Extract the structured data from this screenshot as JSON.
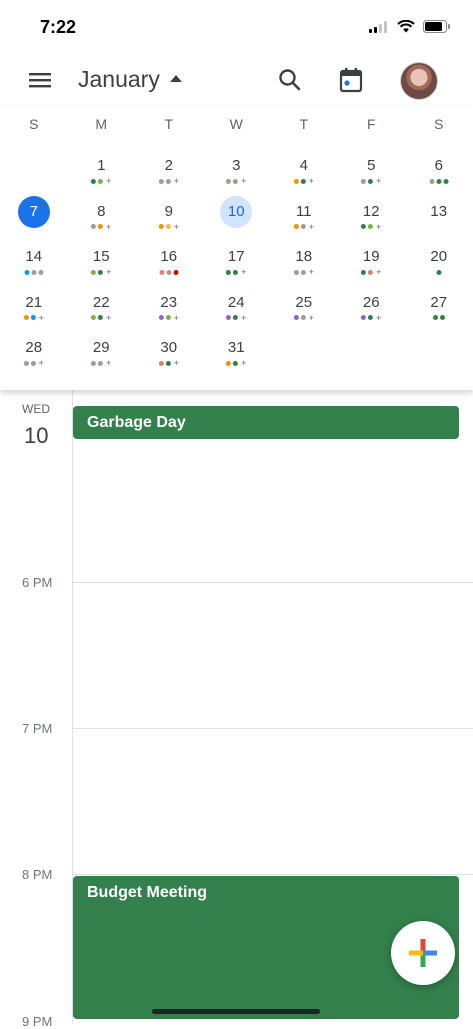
{
  "status_bar": {
    "time": "7:22"
  },
  "header": {
    "month": "January"
  },
  "colors": {
    "accent": "#1a73e8",
    "event_green": "#33804c",
    "selected_bg": "#d2e3fc",
    "dot_palette": {
      "g": "#33804c",
      "G": "#7cb342",
      "o": "#f09300",
      "r": "#e67c73",
      "p": "#8e63ce",
      "b": "#039be5",
      "y": "#e4c441",
      "a": "#a79b8e",
      "t": "#d50000"
    }
  },
  "weekdays": [
    "S",
    "M",
    "T",
    "W",
    "T",
    "F",
    "S"
  ],
  "weeks": [
    [
      {
        "n": "",
        "dots": ""
      },
      {
        "n": "1",
        "dots": "gG+"
      },
      {
        "n": "2",
        "dots": "aa+"
      },
      {
        "n": "3",
        "dots": "aa+"
      },
      {
        "n": "4",
        "dots": "og+"
      },
      {
        "n": "5",
        "dots": "ag+"
      },
      {
        "n": "6",
        "dots": "agg"
      }
    ],
    [
      {
        "n": "7",
        "dots": "",
        "state": "today"
      },
      {
        "n": "8",
        "dots": "ao+"
      },
      {
        "n": "9",
        "dots": "oy+"
      },
      {
        "n": "10",
        "dots": "",
        "state": "selected"
      },
      {
        "n": "11",
        "dots": "oa+"
      },
      {
        "n": "12",
        "dots": "gG+"
      },
      {
        "n": "13",
        "dots": ""
      }
    ],
    [
      {
        "n": "14",
        "dots": "baa"
      },
      {
        "n": "15",
        "dots": "Gg+"
      },
      {
        "n": "16",
        "dots": "rat"
      },
      {
        "n": "17",
        "dots": "gg+"
      },
      {
        "n": "18",
        "dots": "aa+"
      },
      {
        "n": "19",
        "dots": "gr+"
      },
      {
        "n": "20",
        "dots": "g"
      }
    ],
    [
      {
        "n": "21",
        "dots": "ob+"
      },
      {
        "n": "22",
        "dots": "Gg+"
      },
      {
        "n": "23",
        "dots": "pG+"
      },
      {
        "n": "24",
        "dots": "pg+"
      },
      {
        "n": "25",
        "dots": "pa+"
      },
      {
        "n": "26",
        "dots": "pg+"
      },
      {
        "n": "27",
        "dots": "gg"
      }
    ],
    [
      {
        "n": "28",
        "dots": "aa+"
      },
      {
        "n": "29",
        "dots": "aa+"
      },
      {
        "n": "30",
        "dots": "rg+"
      },
      {
        "n": "31",
        "dots": "og+"
      },
      {
        "n": "",
        "dots": ""
      },
      {
        "n": "",
        "dots": ""
      },
      {
        "n": "",
        "dots": ""
      }
    ]
  ],
  "day_view": {
    "weekday": "WED",
    "date": "10",
    "hours": [
      "6 PM",
      "7 PM",
      "8 PM",
      "9 PM"
    ],
    "events": [
      {
        "title": "Garbage Day"
      },
      {
        "title": "Budget Meeting"
      }
    ]
  }
}
